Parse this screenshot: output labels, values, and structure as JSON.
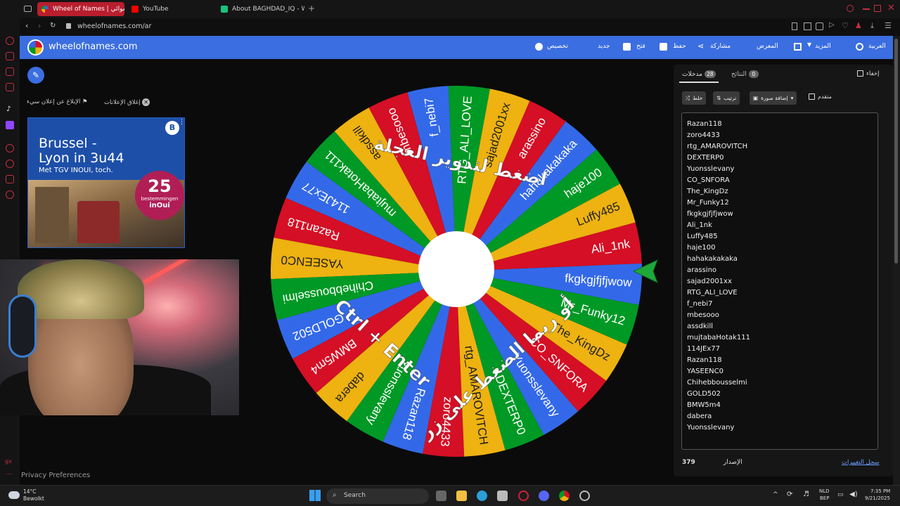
{
  "browser": {
    "tabs": [
      {
        "label": "Wheel of Names | عشوائي",
        "active": true
      },
      {
        "label": "YouTube",
        "active": false
      },
      {
        "label": "About BAGHDAD_IQ - Wa",
        "active": false
      }
    ],
    "new_tab_symbol": "+",
    "url": "wheelofnames.com/ar"
  },
  "site": {
    "title": "wheelofnames.com",
    "nav": {
      "customize": "تخصيص",
      "new": "جديد",
      "open": "فتح",
      "save": "حفظ",
      "share": "مشاركة",
      "gallery": "المعرض",
      "more": "المزيد",
      "language": "العربية"
    }
  },
  "left": {
    "report_ad": "الإبلاغ عن إعلان سيء",
    "close_ads": "إغلاق الإعلانات",
    "ad": {
      "line1": "Brussel -",
      "line2": "Lyon in 3u44",
      "line3": "Met TGV INOUI, toch.",
      "badge_number": "25",
      "badge_text": "bestemmingen",
      "badge_brand": "inOui",
      "logo": "B"
    },
    "privacy": "Privacy Preferences"
  },
  "wheel": {
    "colors": [
      "#3369e8",
      "#d50f25",
      "#eeb211",
      "#009925"
    ],
    "segments": [
      "fkgkgjfjfjwow",
      "Ali_1nk",
      "Luffy485",
      "haje100",
      "hahakakakaka",
      "arassino",
      "sajad2001xx",
      "RTG_ALI_LOVE",
      "f_nebi7",
      "mbesooo",
      "assdkill",
      "mujtabaHotak111",
      "114JEx77",
      "Razan118",
      "YASEENC0",
      "Chihebbousselmi",
      "GOLD502",
      "BMW5m4",
      "dabera",
      "Yuonsslevany",
      "Razan118",
      "zoro4433",
      "rtg_AMAROVITCH",
      "DEXTERP0",
      "Yuonsslevany",
      "CO_SNFORA",
      "The_KingDz",
      "Mr_Funky12"
    ],
    "overlay_top": "اضغط لتدوير العجلة",
    "overlay_bottom_ar": "أو ربما الضغط على زر",
    "overlay_bottom_keys": "Ctrl + Enter"
  },
  "panel": {
    "entries_tab": "مدخلات",
    "entries_count": "28",
    "results_tab": "النتائج",
    "results_count": "0",
    "hide_label": "إخفاء",
    "shuffle": "خلط",
    "sort": "ترتيب",
    "add_image": "إضافة صورة",
    "advanced": "متقدم",
    "entries": [
      "Razan118",
      "zoro4433",
      "rtg_AMAROVITCH",
      "DEXTERP0",
      "Yuonsslevany",
      "CO_SNFORA",
      "The_KingDz",
      "Mr_Funky12",
      "fkgkgjfjfjwow",
      "Ali_1nk",
      "Luffy485",
      "haje100",
      "hahakakakaka",
      "arassino",
      "sajad2001xx",
      "RTG_ALI_LOVE",
      "f_nebi7",
      "mbesooo",
      "assdkill",
      "mujtabaHotak111",
      "114JEx77",
      "Razan118",
      "YASEENC0",
      "Chihebbousselmi",
      "GOLD502",
      "BMW5m4",
      "dabera",
      "Yuonsslevany"
    ],
    "version_label": "الإصدار",
    "version_number": "379",
    "changelog": "سجل التغييرات"
  },
  "taskbar": {
    "temperature": "14°C",
    "weather": "Bewolkt",
    "search": "Search",
    "lang1": "NLD",
    "lang2": "BEP",
    "time": "7:35 PM",
    "date": "9/21/2025"
  }
}
